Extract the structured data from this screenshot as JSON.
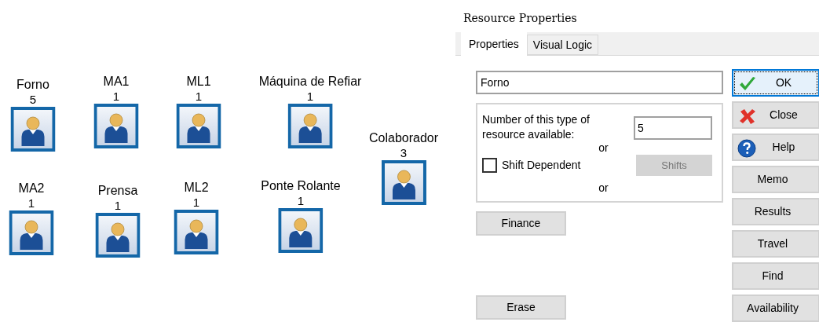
{
  "resources": [
    {
      "name": "Forno",
      "count": "5"
    },
    {
      "name": "MA1",
      "count": "1"
    },
    {
      "name": "ML1",
      "count": "1"
    },
    {
      "name": "Máquina de Refiar",
      "count": "1"
    },
    {
      "name": "Colaborador",
      "count": "3"
    },
    {
      "name": "MA2",
      "count": "1"
    },
    {
      "name": "Prensa",
      "count": "1"
    },
    {
      "name": "ML2",
      "count": "1"
    },
    {
      "name": "Ponte Rolante",
      "count": "1"
    }
  ],
  "dialog": {
    "title": "Resource Properties",
    "tabs": [
      {
        "label": "Properties",
        "selected": true
      },
      {
        "label": "Visual Logic",
        "selected": false
      }
    ],
    "name_value": "Forno",
    "number_label": "Number of this type of resource available:",
    "number_value": "5",
    "or_texts": [
      "or",
      "or"
    ],
    "shift_dependent": {
      "label": "Shift Dependent",
      "checked": false
    },
    "shifts_button": {
      "label": "Shifts",
      "disabled": true
    },
    "finance_button": "Finance",
    "erase_button": "Erase",
    "side_buttons": [
      {
        "label": "OK",
        "kind": "ok",
        "focused": true
      },
      {
        "label": "Close",
        "kind": "close",
        "focused": false
      },
      {
        "label": "Help",
        "kind": "help",
        "focused": false
      },
      {
        "label": "Memo",
        "kind": "plain",
        "focused": false
      },
      {
        "label": "Results",
        "kind": "plain",
        "focused": false
      },
      {
        "label": "Travel",
        "kind": "plain",
        "focused": false
      },
      {
        "label": "Find",
        "kind": "plain",
        "focused": false
      },
      {
        "label": "Availability",
        "kind": "plain",
        "focused": false
      }
    ]
  }
}
